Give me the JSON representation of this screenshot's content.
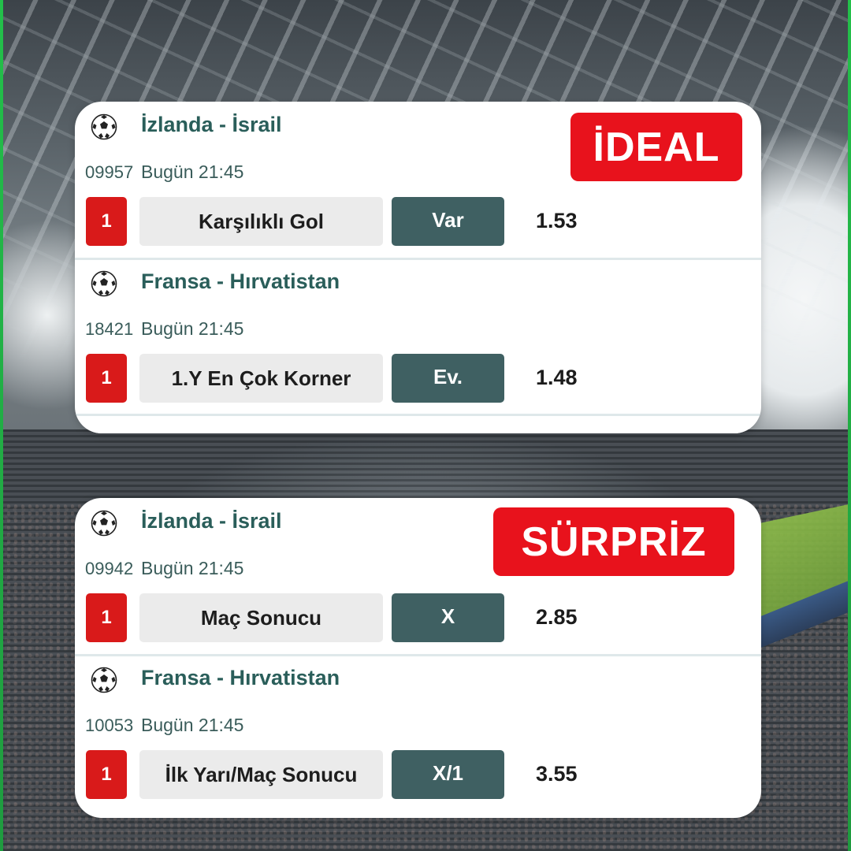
{
  "cards": [
    {
      "tag": "İDEAL",
      "tag_color": "#e8121c",
      "matches": [
        {
          "teams": "İzlanda - İsrail",
          "code": "09957",
          "time": "Bugün 21:45",
          "number": "1",
          "market": "Karşılıklı Gol",
          "pick": "Var",
          "odds": "1.53"
        },
        {
          "teams": "Fransa - Hırvatistan",
          "code": "18421",
          "time": "Bugün 21:45",
          "number": "1",
          "market": "1.Y En Çok Korner",
          "pick": "Ev.",
          "odds": "1.48"
        }
      ]
    },
    {
      "tag": "SÜRPRİZ",
      "tag_color": "#e8121c",
      "matches": [
        {
          "teams": "İzlanda - İsrail",
          "code": "09942",
          "time": "Bugün 21:45",
          "number": "1",
          "market": "Maç Sonucu",
          "pick": "X",
          "odds": "2.85"
        },
        {
          "teams": "Fransa - Hırvatistan",
          "code": "10053",
          "time": "Bugün 21:45",
          "number": "1",
          "market": "İlk Yarı/Maç Sonucu",
          "pick": "X/1",
          "odds": "3.55"
        }
      ]
    }
  ],
  "colors": {
    "team_text": "#2a5e5a",
    "pick_bg": "#3f6062",
    "number_badge": "#d91a1a",
    "market_bg": "#ebebeb"
  },
  "icons": {
    "sport": "soccer-ball-icon"
  }
}
